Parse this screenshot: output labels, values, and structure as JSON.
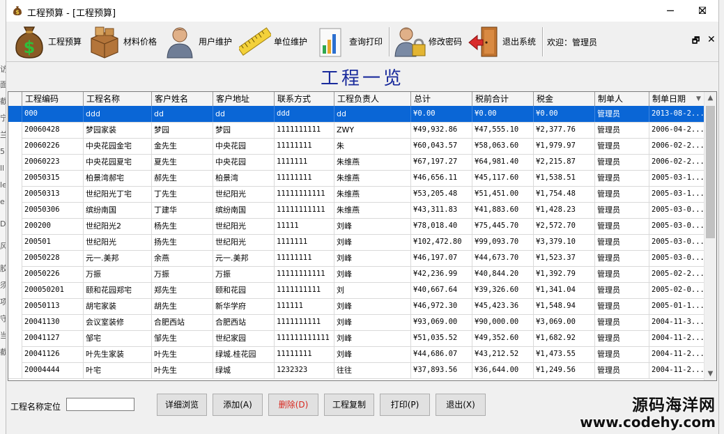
{
  "window": {
    "title": "工程预算 - [工程预算]",
    "min_glyph": "─",
    "max_glyph": "☐",
    "close_glyph": "✕"
  },
  "toolbar": {
    "items": [
      {
        "label": "工程预算",
        "icon": "money-bag-icon"
      },
      {
        "label": "材料价格",
        "icon": "boxes-icon"
      },
      {
        "label": "用户维护",
        "icon": "user-icon"
      },
      {
        "label": "单位维护",
        "icon": "ruler-icon"
      },
      {
        "label": "查询打印",
        "icon": "chart-icon"
      },
      {
        "label": "修改密码",
        "icon": "user-lock-icon"
      },
      {
        "label": "退出系统",
        "icon": "exit-door-icon"
      }
    ],
    "welcome": "欢迎：管理员",
    "mdi_restore": "🗗",
    "mdi_close": "✕"
  },
  "page": {
    "heading": "工程一览"
  },
  "table": {
    "columns": [
      "工程编码",
      "工程名称",
      "客户姓名",
      "客户地址",
      "联系方式",
      "工程负责人",
      "总计",
      "税前合计",
      "税金",
      "制单人",
      "制单日期"
    ],
    "rows": [
      [
        "000",
        "ddd",
        "dd",
        "dd",
        "ddd",
        "dd",
        "¥0.00",
        "¥0.00",
        "¥0.00",
        "管理员",
        "2013-08-2..."
      ],
      [
        "20060428",
        "梦园家装",
        "梦园",
        "梦园",
        "1111111111",
        "ZWY",
        "¥49,932.86",
        "¥47,555.10",
        "¥2,377.76",
        "管理员",
        "2006-04-2..."
      ],
      [
        "20060226",
        "中央花园金宅",
        "金先生",
        "中央花园",
        "11111111",
        "朱",
        "¥60,043.57",
        "¥58,063.60",
        "¥1,979.97",
        "管理员",
        "2006-02-2..."
      ],
      [
        "20060223",
        "中央花园夏宅",
        "夏先生",
        "中央花园",
        "1111111",
        "朱维燕",
        "¥67,197.27",
        "¥64,981.40",
        "¥2,215.87",
        "管理员",
        "2006-02-2..."
      ],
      [
        "20050315",
        "柏景湾郝宅",
        "郝先生",
        "柏景湾",
        "11111111",
        "朱维燕",
        "¥46,656.11",
        "¥45,117.60",
        "¥1,538.51",
        "管理员",
        "2005-03-1..."
      ],
      [
        "20050313",
        "世纪阳光丁宅",
        "丁先生",
        "世纪阳光",
        "11111111111",
        "朱维燕",
        "¥53,205.48",
        "¥51,451.00",
        "¥1,754.48",
        "管理员",
        "2005-03-1..."
      ],
      [
        "20050306",
        "缤纷南国",
        "丁建华",
        "缤纷南国",
        "11111111111",
        "朱维燕",
        "¥43,311.83",
        "¥41,883.60",
        "¥1,428.23",
        "管理员",
        "2005-03-0..."
      ],
      [
        "200200",
        "世纪阳光2",
        "杨先生",
        "世纪阳光",
        "11111",
        "刘峰",
        "¥78,018.40",
        "¥75,445.70",
        "¥2,572.70",
        "管理员",
        "2005-03-0..."
      ],
      [
        "200501",
        "世纪阳光",
        "扬先生",
        "世纪阳光",
        "1111111",
        "刘峰",
        "¥102,472.80",
        "¥99,093.70",
        "¥3,379.10",
        "管理员",
        "2005-03-0..."
      ],
      [
        "20050228",
        "元一.美邦",
        "余燕",
        "元一.美邦",
        "11111111",
        "刘峰",
        "¥46,197.07",
        "¥44,673.70",
        "¥1,523.37",
        "管理员",
        "2005-03-0..."
      ],
      [
        "20050226",
        "万振",
        "万振",
        "万振",
        "11111111111",
        "刘峰",
        "¥42,236.99",
        "¥40,844.20",
        "¥1,392.79",
        "管理员",
        "2005-02-2..."
      ],
      [
        "200050201",
        "颐和花园郑宅",
        "郑先生",
        "颐和花园",
        "1111111111",
        "刘",
        "¥40,667.64",
        "¥39,326.60",
        "¥1,341.04",
        "管理员",
        "2005-02-0..."
      ],
      [
        "20050113",
        "胡宅家装",
        "胡先生",
        "新华学府",
        "111111",
        "刘峰",
        "¥46,972.30",
        "¥45,423.36",
        "¥1,548.94",
        "管理员",
        "2005-01-1..."
      ],
      [
        "20041130",
        "会议室装修",
        "合肥西站",
        "合肥西站",
        "1111111111",
        "刘峰",
        "¥93,069.00",
        "¥90,000.00",
        "¥3,069.00",
        "管理员",
        "2004-11-3..."
      ],
      [
        "20041127",
        "邹宅",
        "邹先生",
        "世纪家园",
        "111111111111",
        "刘峰",
        "¥51,035.52",
        "¥49,352.60",
        "¥1,682.92",
        "管理员",
        "2004-11-2..."
      ],
      [
        "20041126",
        "叶先生家装",
        "叶先生",
        "绿城.桂花园",
        "11111111",
        "刘峰",
        "¥44,686.07",
        "¥43,212.52",
        "¥1,473.55",
        "管理员",
        "2004-11-2..."
      ],
      [
        "20004444",
        "叶宅",
        "叶先生",
        "绿城",
        "1232323",
        "往往",
        "¥37,893.56",
        "¥36,644.00",
        "¥1,249.56",
        "管理员",
        "2004-11-2..."
      ]
    ]
  },
  "bottom": {
    "locate_label": "工程名称定位",
    "locate_value": "",
    "buttons": [
      {
        "label": "详细浏览",
        "name": "detail-button"
      },
      {
        "label": "添加(A)",
        "name": "add-button"
      },
      {
        "label": "删除(D)",
        "name": "delete-button",
        "danger": true
      },
      {
        "label": "工程复制",
        "name": "copy-button"
      },
      {
        "label": "打印(P)",
        "name": "print-button"
      },
      {
        "label": "退出(X)",
        "name": "exit-button"
      }
    ]
  },
  "watermark": {
    "line1": "源码海洋网",
    "line2": "www.codehy.com"
  },
  "colors": {
    "selection": "#0a66d6",
    "heading": "#1a2b9c",
    "danger": "#d8261e"
  }
}
